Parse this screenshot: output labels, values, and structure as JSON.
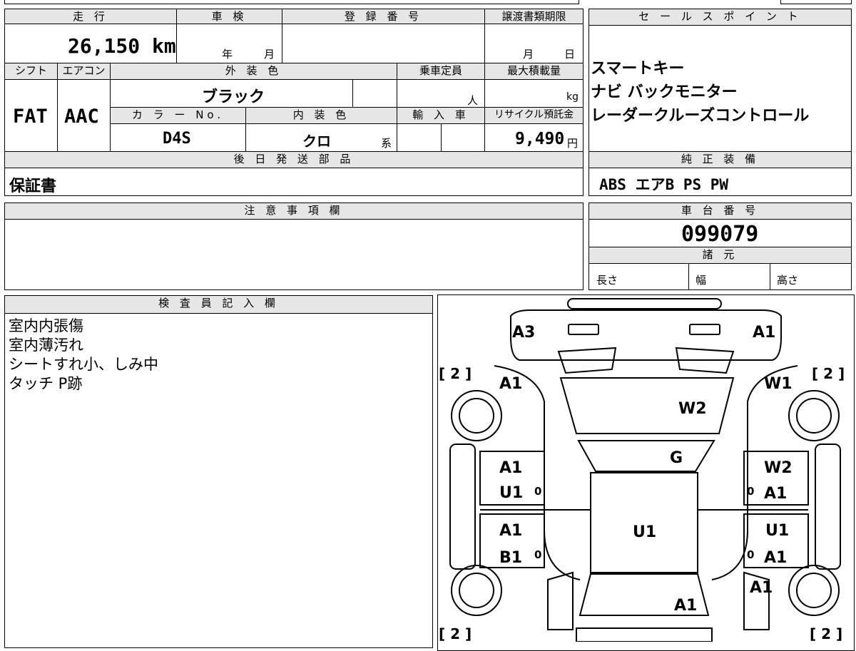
{
  "top": {
    "headers": {
      "mileage": "走 行",
      "inspection": "車 検",
      "registration": "登 録 番 号",
      "transfer_deadline": "譲渡書類期限",
      "sales_point": "セ ー ル ス ポ イ ン ト"
    },
    "mileage_value": "26,150 km",
    "inspection_year": "年",
    "inspection_month": "月",
    "transfer_month": "月",
    "transfer_day": "日"
  },
  "specs": {
    "headers": {
      "shift": "シフト",
      "aircon": "エアコン",
      "exterior": "外 装 色",
      "capacity": "乗車定員",
      "max_load": "最大積載量",
      "color_no": "カ ラ ー No.",
      "interior": "内 装 色",
      "import": "輸 入 車",
      "recycle": "リサイクル預託金"
    },
    "shift": "FAT",
    "aircon": "AAC",
    "exterior_color": "ブラック",
    "capacity_unit": "人",
    "load_unit": "kg",
    "color_no": "D4S",
    "interior_color": "クロ",
    "interior_suffix": "系",
    "recycle_value": "9,490",
    "recycle_unit": "円"
  },
  "sales_points": [
    "スマートキー",
    "ナビ バックモニター",
    "レーダークルーズコントロール"
  ],
  "later_parts": {
    "header": "後 日 発 送 部 品",
    "value": "保証書"
  },
  "genuine_equipment": {
    "header": "純 正 装 備",
    "value": "ABS エアB PS PW"
  },
  "notes": {
    "header": "注 意 事 項 欄"
  },
  "chassis": {
    "header": "車 台 番 号",
    "value": "099079"
  },
  "dimensions": {
    "header": "諸 元",
    "length": "長さ",
    "width": "幅",
    "height": "高さ"
  },
  "inspector": {
    "header": "検 査 員 記 入 欄",
    "lines": [
      "室内内張傷",
      "室内薄汚れ",
      "シートすれ小、しみ中",
      "タッチ P跡"
    ]
  },
  "car_map": {
    "labels": {
      "front_left_corner": "A3",
      "front_right_corner": "A1",
      "left_front_fender": "A1",
      "right_front_fender": "W1",
      "hood": "W2",
      "windshield": "G",
      "left_front_door_1": "A1",
      "left_front_door_2": "U1",
      "left_rear_door_1": "A1",
      "left_rear_door_2": "B1",
      "right_front_door_1": "W2",
      "right_front_door_2": "A1",
      "right_rear_door_1": "U1",
      "right_rear_door_2": "A1",
      "roof": "U1",
      "right_rear_fender": "A1",
      "trunk": "A1"
    },
    "tire_marks": [
      "[ 2 ]",
      "[ 2 ]",
      "[ 2 ]",
      "[ 2 ]"
    ],
    "zero_marks": [
      "0",
      "0",
      "0",
      "0"
    ]
  }
}
